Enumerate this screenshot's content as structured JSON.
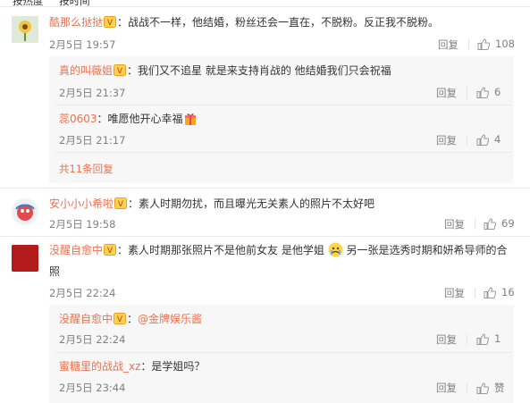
{
  "sort": {
    "hot": "按热度",
    "time": "按时间"
  },
  "comments": [
    {
      "user": "酷那么挞挞",
      "text": "：战战不一样，他结婚，粉丝还会一直在，不脱粉。反正我不脱粉。",
      "time": "2月5日 19:57",
      "reply": "回复",
      "likes": "108",
      "replies": [
        {
          "user": "真的叫薇姐",
          "text": "：我们又不追星 就是来支持肖战的 他结婚我们只会祝福",
          "time": "2月5日 21:37",
          "reply": "回复",
          "likes": "6"
        },
        {
          "user": "蕊0603",
          "text": "：唯愿他开心幸福",
          "time": "2月5日 21:17",
          "reply": "回复",
          "likes": "4"
        }
      ],
      "more": "共11条回复"
    },
    {
      "user": "安小小小希啦",
      "text": "：素人时期勿扰，而且曝光无关素人的照片不太好吧",
      "time": "2月5日 19:58",
      "reply": "回复",
      "likes": "69"
    },
    {
      "user": "没醒自愈中",
      "text1": "：素人时期那张照片不是他前女友 是他学姐",
      "text2": "另一张是选秀时期和妍希导师的合",
      "text3": "照",
      "time": "2月5日 22:24",
      "reply": "回复",
      "likes": "16",
      "replies": [
        {
          "user": "没醒自愈中",
          "text": "：",
          "mention": "@金牌娱乐酱",
          "time": "2月5日 22:24",
          "reply": "回复",
          "likes": "1"
        },
        {
          "user": "蜜糖里的战战_xz",
          "text": "：是学姐吗？",
          "time": "2月5日 23:44",
          "reply": "回复",
          "likes": "赞"
        }
      ]
    }
  ],
  "colors": {
    "accent": "#eb7350",
    "muted": "#808080",
    "sub_bg": "#f7f7f7"
  }
}
